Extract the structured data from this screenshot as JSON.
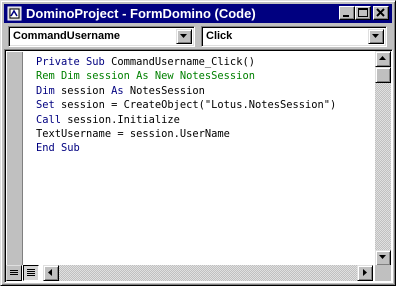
{
  "window": {
    "title": "DominoProject - FormDomino (Code)"
  },
  "object_combo": {
    "value": "CommandUsername"
  },
  "procedure_combo": {
    "value": "Click"
  },
  "code_lines": [
    [
      {
        "t": "Private Sub ",
        "c": "kw"
      },
      {
        "t": "CommandUsername_Click()",
        "c": "plain"
      }
    ],
    [
      {
        "t": "Rem Dim session As New NotesSession",
        "c": "cmt"
      }
    ],
    [
      {
        "t": "Dim ",
        "c": "kw"
      },
      {
        "t": "session ",
        "c": "plain"
      },
      {
        "t": "As ",
        "c": "kw"
      },
      {
        "t": "NotesSession",
        "c": "plain"
      }
    ],
    [
      {
        "t": "Set ",
        "c": "kw"
      },
      {
        "t": "session = CreateObject(\"Lotus.NotesSession\")",
        "c": "plain"
      }
    ],
    [
      {
        "t": "Call ",
        "c": "kw"
      },
      {
        "t": "session.Initialize",
        "c": "plain"
      }
    ],
    [
      {
        "t": "TextUsername = session.UserName",
        "c": "plain"
      }
    ],
    [
      {
        "t": "End Sub",
        "c": "kw"
      }
    ]
  ],
  "colors": {
    "titlebar": "#000080",
    "keyword": "#000080",
    "comment": "#008000",
    "plain": "#000000"
  },
  "icons": {
    "title": "vb-form-icon",
    "minimize": "minimize-icon",
    "maximize": "maximize-icon",
    "close": "close-icon",
    "dropdown": "chevron-down-icon",
    "procedure_view": "procedure-view-icon",
    "full_module_view": "full-module-view-icon"
  }
}
